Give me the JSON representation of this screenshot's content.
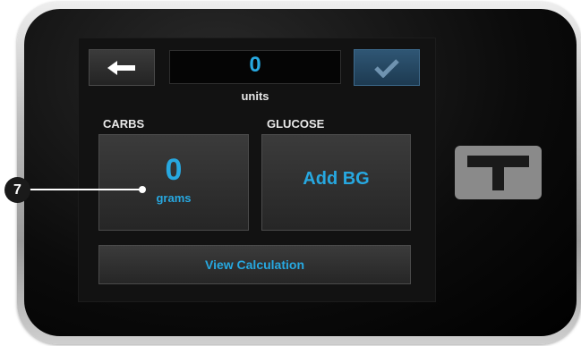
{
  "colors": {
    "accent": "#27a8e0",
    "screen_bg": "#121212",
    "tile_bg": "#2f2f2f",
    "confirm_bg": "#27506e"
  },
  "header": {
    "back_icon": "arrow-left-icon",
    "units_value": "0",
    "units_label": "units",
    "confirm_icon": "checkmark-icon"
  },
  "sections": {
    "carbs_label": "CARBS",
    "glucose_label": "GLUCOSE"
  },
  "carbs": {
    "value": "0",
    "unit": "grams"
  },
  "glucose": {
    "action_label": "Add BG"
  },
  "footer": {
    "view_calculation_label": "View Calculation"
  },
  "brand": {
    "logo_icon": "t-logo-icon"
  },
  "callout": {
    "number": "7"
  }
}
